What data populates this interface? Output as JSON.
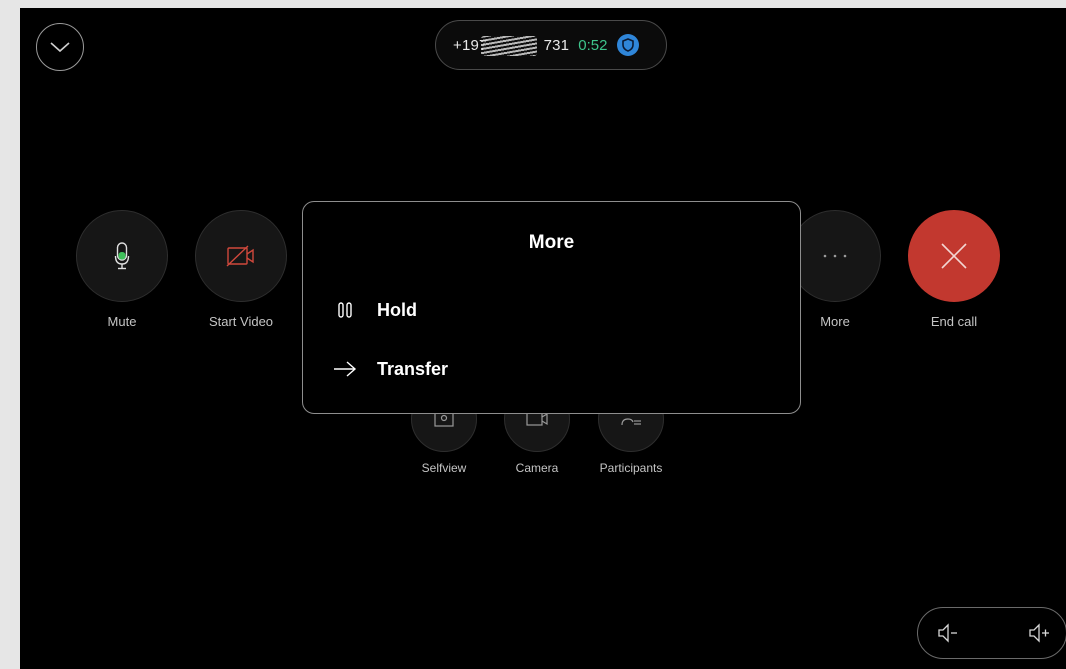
{
  "call": {
    "number_prefix": "+197",
    "number_suffix": "731",
    "timer": "0:52",
    "encryption_icon": "shield-icon"
  },
  "controls": [
    {
      "id": "mute",
      "label": "Mute",
      "icon": "microphone-icon"
    },
    {
      "id": "start-video",
      "label": "Start Video",
      "icon": "camera-off-icon"
    },
    {
      "id": "more",
      "label": "More",
      "icon": "more-dots-icon"
    },
    {
      "id": "end-call",
      "label": "End call",
      "icon": "close-icon"
    }
  ],
  "secondary_controls": [
    {
      "id": "selfview",
      "label": "Selfview",
      "icon": "selfview-icon"
    },
    {
      "id": "camera",
      "label": "Camera",
      "icon": "camera-control-icon"
    },
    {
      "id": "participants",
      "label": "Participants",
      "icon": "participants-icon"
    }
  ],
  "more_menu": {
    "title": "More",
    "items": [
      {
        "label": "Hold",
        "icon": "pause-icon"
      },
      {
        "label": "Transfer",
        "icon": "arrow-right-icon"
      }
    ]
  },
  "volume": {
    "down_icon": "volume-down-icon",
    "up_icon": "volume-up-icon"
  },
  "colors": {
    "background": "#000000",
    "end_call": "#c2382f",
    "timer": "#3ec48c",
    "mic_active": "#3fbf5a",
    "video_off": "#d0483c",
    "shield": "#2f86d9"
  }
}
